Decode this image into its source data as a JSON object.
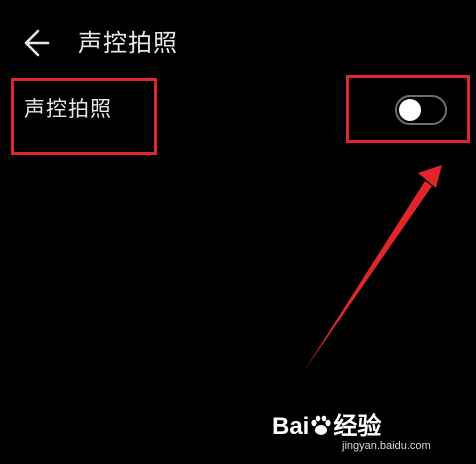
{
  "header": {
    "back_icon": "arrow-left-icon",
    "title": "声控拍照"
  },
  "setting": {
    "label": "声控拍照",
    "toggle_state": "off"
  },
  "annotations": {
    "color": "#e0262a"
  },
  "watermark": {
    "brand_prefix": "Bai",
    "brand_suffix": "经验",
    "sub": "jingyan.baidu.com"
  },
  "colors": {
    "background": "#000000",
    "text": "#e8e8e8",
    "toggle_knob": "#ffffff",
    "toggle_border": "#6f6f6f"
  }
}
